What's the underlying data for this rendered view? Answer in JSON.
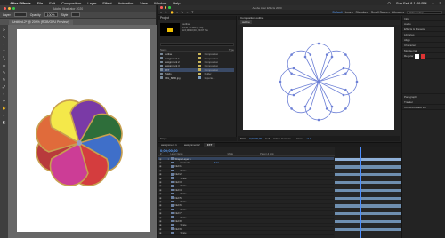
{
  "menubar": {
    "app": "After Effects",
    "items": [
      "File",
      "Edit",
      "Composition",
      "Layer",
      "Effect",
      "Animation",
      "View",
      "Window",
      "Help"
    ],
    "clock": "Sun Feb 8 1:29 PM"
  },
  "illustrator": {
    "window_title": "Adobe Illustrator 2020",
    "tab": "Untitled-2* @ 200% (RGB/GPU Preview)",
    "control": {
      "layer_label": "Layer",
      "opacity_label": "Opacity",
      "opacity_value": "100%",
      "style_label": "Style"
    },
    "petal_colors": [
      "#b83a3c",
      "#e06b3b",
      "#f4e84a",
      "#7a3aa6",
      "#2e6e3a",
      "#3f6fc9",
      "#d43d3e",
      "#cc3d96"
    ]
  },
  "ae": {
    "window_title": "Adobe After Effects 2020",
    "workspaces": [
      "Default",
      "Learn",
      "Standard",
      "Small Screen",
      "Libraries"
    ],
    "search_placeholder": "Search Help",
    "project": {
      "panel_label": "Project",
      "comp_name": "outline",
      "meta": [
        "1920 x 1080 (1.00)",
        "Δ 0;00;10;00, 29.97 fps"
      ],
      "columns": [
        "Name",
        "Type"
      ],
      "items": [
        {
          "name": "outline",
          "type": "Composition",
          "label_color": "#c8b45a",
          "selected": false
        },
        {
          "name": "assignment 1",
          "type": "Composition",
          "label_color": "#c8b45a",
          "selected": false
        },
        {
          "name": "assignment 2",
          "type": "Composition",
          "label_color": "#c8b45a",
          "selected": false
        },
        {
          "name": "assignment 3",
          "type": "Composition",
          "label_color": "#c8b45a",
          "selected": false
        },
        {
          "name": "FXT",
          "type": "Composition",
          "label_color": "#c8b45a",
          "selected": true
        },
        {
          "name": "Solids",
          "type": "Folder",
          "label_color": "#c8b45a",
          "selected": false
        },
        {
          "name": "IMG_8830.jpg",
          "type": "Importe...",
          "label_color": "#7fa0c0",
          "selected": false
        }
      ],
      "footer": "8 bpc"
    },
    "composition": {
      "tab": "Composition outline",
      "sub_tab": "outline",
      "footer": {
        "zoom": "50%",
        "time": "0;00;00;00",
        "quality": "Full",
        "camera": "Active Camera",
        "view": "1 View",
        "offset": "+0.0"
      }
    },
    "properties": [
      "Info",
      "Audio",
      "Effects & Presets",
      "Libraries",
      "Align",
      "Character",
      "Paragraph",
      "Tracker",
      "Content-Aware Fill"
    ],
    "character": {
      "font": "Montserrat",
      "style": "Regular"
    },
    "timeline": {
      "tabs": [
        "assignment 1",
        "assignment 2",
        "FXT"
      ],
      "active_tab": "FXT",
      "current_time": "0;00;00;00",
      "columns": [
        "#",
        "Layer Name",
        "Mode",
        "Parent & Link"
      ],
      "layers": [
        {
          "idx": "1",
          "name": "Shape Layer 1",
          "value": "",
          "selected": true,
          "sub": false
        },
        {
          "idx": "",
          "name": "Contents",
          "value": "Add",
          "selected": false,
          "sub": true
        },
        {
          "idx": "",
          "name": "Null 1",
          "value": "",
          "selected": false,
          "sub": false
        },
        {
          "idx": "",
          "name": "Scale",
          "value": "",
          "selected": false,
          "sub": true
        },
        {
          "idx": "",
          "name": "Null 2",
          "value": "",
          "selected": false,
          "sub": false
        },
        {
          "idx": "",
          "name": "Scale",
          "value": "",
          "selected": false,
          "sub": true
        },
        {
          "idx": "",
          "name": "Null 3",
          "value": "",
          "selected": false,
          "sub": false
        },
        {
          "idx": "",
          "name": "Scale",
          "value": "",
          "selected": false,
          "sub": true
        },
        {
          "idx": "",
          "name": "Null 4",
          "value": "",
          "selected": false,
          "sub": false
        },
        {
          "idx": "",
          "name": "Scale",
          "value": "",
          "selected": false,
          "sub": true
        },
        {
          "idx": "",
          "name": "Null 5",
          "value": "",
          "selected": false,
          "sub": false
        },
        {
          "idx": "",
          "name": "Scale",
          "value": "",
          "selected": false,
          "sub": true
        },
        {
          "idx": "",
          "name": "Null 6",
          "value": "",
          "selected": false,
          "sub": false
        },
        {
          "idx": "",
          "name": "Scale",
          "value": "",
          "selected": false,
          "sub": true
        },
        {
          "idx": "",
          "name": "Null 7",
          "value": "",
          "selected": false,
          "sub": false
        },
        {
          "idx": "",
          "name": "Scale",
          "value": "",
          "selected": false,
          "sub": true
        },
        {
          "idx": "",
          "name": "Null 8",
          "value": "",
          "selected": false,
          "sub": false
        },
        {
          "idx": "",
          "name": "Scale",
          "value": "",
          "selected": false,
          "sub": true
        },
        {
          "idx": "",
          "name": "Null 9",
          "value": "",
          "selected": false,
          "sub": false
        },
        {
          "idx": "",
          "name": "Scale",
          "value": "",
          "selected": false,
          "sub": true
        }
      ]
    }
  }
}
